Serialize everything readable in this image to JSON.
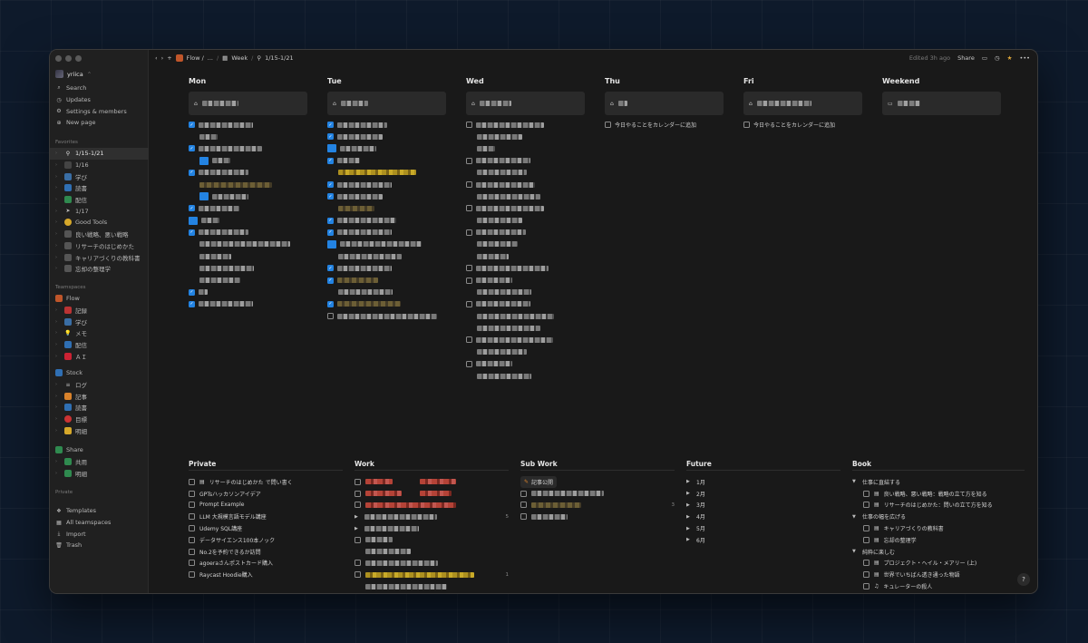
{
  "sidebar": {
    "workspace": "yriica",
    "nav": [
      {
        "label": "Search",
        "icon": "search-icon"
      },
      {
        "label": "Updates",
        "icon": "clock-icon"
      },
      {
        "label": "Settings & members",
        "icon": "gear-icon"
      },
      {
        "label": "New page",
        "icon": "plus-icon"
      }
    ],
    "favorites_head": "Favorites",
    "favorites": [
      "1/15-1/21",
      "1/16",
      "学び",
      "読書",
      "配信",
      "1/17",
      "Good Tools",
      "良い戦略、悪い戦略",
      "リサーチのはじめかた",
      "キャリアづくりの教科書",
      "忘却の整理学"
    ],
    "teamspaces_head": "Teamspaces",
    "flow": {
      "label": "Flow",
      "children": [
        "記録",
        "学び",
        "メモ",
        "配信",
        "ＡＩ"
      ]
    },
    "stock": {
      "label": "Stock",
      "children": [
        "ログ",
        "記事",
        "読書",
        "目標",
        "明細"
      ]
    },
    "share": {
      "label": "Share",
      "children": [
        "共用",
        "明細"
      ]
    },
    "private_head": "Private",
    "bottom": [
      "Templates",
      "All teamspaces",
      "Import",
      "Trash"
    ]
  },
  "topbar": {
    "crumbs": [
      "Flow /",
      "...",
      "Week",
      "1/15-1/21"
    ],
    "edited": "Edited 3h ago",
    "share": "Share"
  },
  "days": [
    {
      "name": "Mon"
    },
    {
      "name": "Tue"
    },
    {
      "name": "Wed"
    },
    {
      "name": "Thu",
      "add": "今日やることをカレンダーに追加"
    },
    {
      "name": "Fri",
      "add": "今日やることをカレンダーに追加"
    },
    {
      "name": "Weekend"
    }
  ],
  "private": {
    "title": "Private",
    "items": [
      "リサーチのはじめかた で問い書く",
      "GPTsハッカソンアイデア",
      "Prompt Example",
      "LLM 大規模言語モデル講座",
      "Udemy SQL講座",
      "データサイエンス100本ノック",
      "No.2を予約できるか訪問",
      "agoeraさんポストカード購入",
      "Raycast Hoodie購入"
    ]
  },
  "work": {
    "title": "Work",
    "counts": [
      "5",
      "1"
    ]
  },
  "subwork": {
    "title": "Sub Work",
    "tag": "記事公開",
    "count": "3"
  },
  "future": {
    "title": "Future",
    "months": [
      "1月",
      "2月",
      "3月",
      "4月",
      "5月",
      "6月"
    ]
  },
  "book": {
    "title": "Book",
    "groups": [
      {
        "label": "仕事に直結する",
        "items": [
          "良い戦略、悪い戦略：戦略の立て方を知る",
          "リサーチのはじめかた：問いの立て方を知る"
        ]
      },
      {
        "label": "仕事の幅を広げる",
        "items": [
          "キャリアづくりの教科書",
          "忘却の整理学"
        ]
      },
      {
        "label": "純粋に楽しむ",
        "items": [
          "プロジェクト・ヘイル・メアリー (上)",
          "世界でいちばん透き通った物語",
          "キュレーターの殺人"
        ]
      }
    ]
  },
  "help": "?"
}
